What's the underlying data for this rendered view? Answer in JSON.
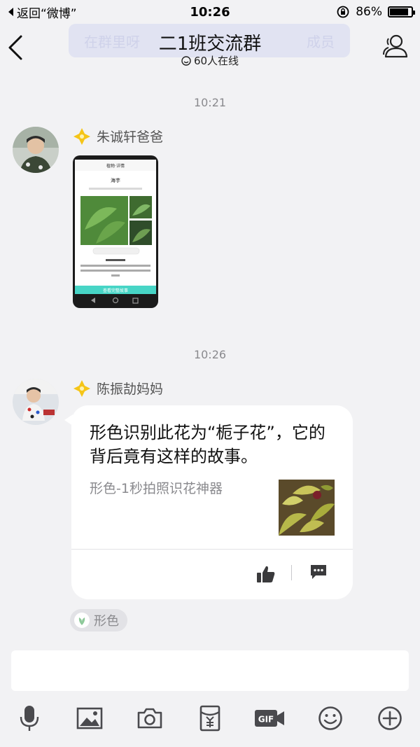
{
  "status_bar": {
    "back_app": "返回“微博”",
    "time": "10:26",
    "battery_percent": "86%",
    "battery_level": 0.86
  },
  "header": {
    "ghost_text_left": "在群里呀",
    "ghost_text_right": "成员",
    "title": "二1班交流群",
    "online": "60人在线"
  },
  "messages": [
    {
      "time": "10:21",
      "sender": "朱诚轩爸爸",
      "type": "image"
    },
    {
      "time": "10:26",
      "sender": "陈振劼妈妈",
      "type": "card",
      "card": {
        "text": "形色识别此花为“栀子花”，它的背后竟有这样的故事。",
        "source": "形色-1秒拍照识花神器"
      },
      "app_tag": "形色"
    }
  ],
  "phone_screenshot": {
    "title": "植物·详情",
    "plant_name": "海芋",
    "button": "查看完整故事"
  },
  "colors": {
    "background": "#f2f2f4",
    "bubble": "#ffffff",
    "badge": "#f5c518",
    "accent": "#47d5c6"
  },
  "toolbar": {
    "icons": [
      "microphone-icon",
      "image-icon",
      "camera-icon",
      "red-packet-icon",
      "gif-icon",
      "emoji-icon",
      "plus-icon"
    ]
  }
}
